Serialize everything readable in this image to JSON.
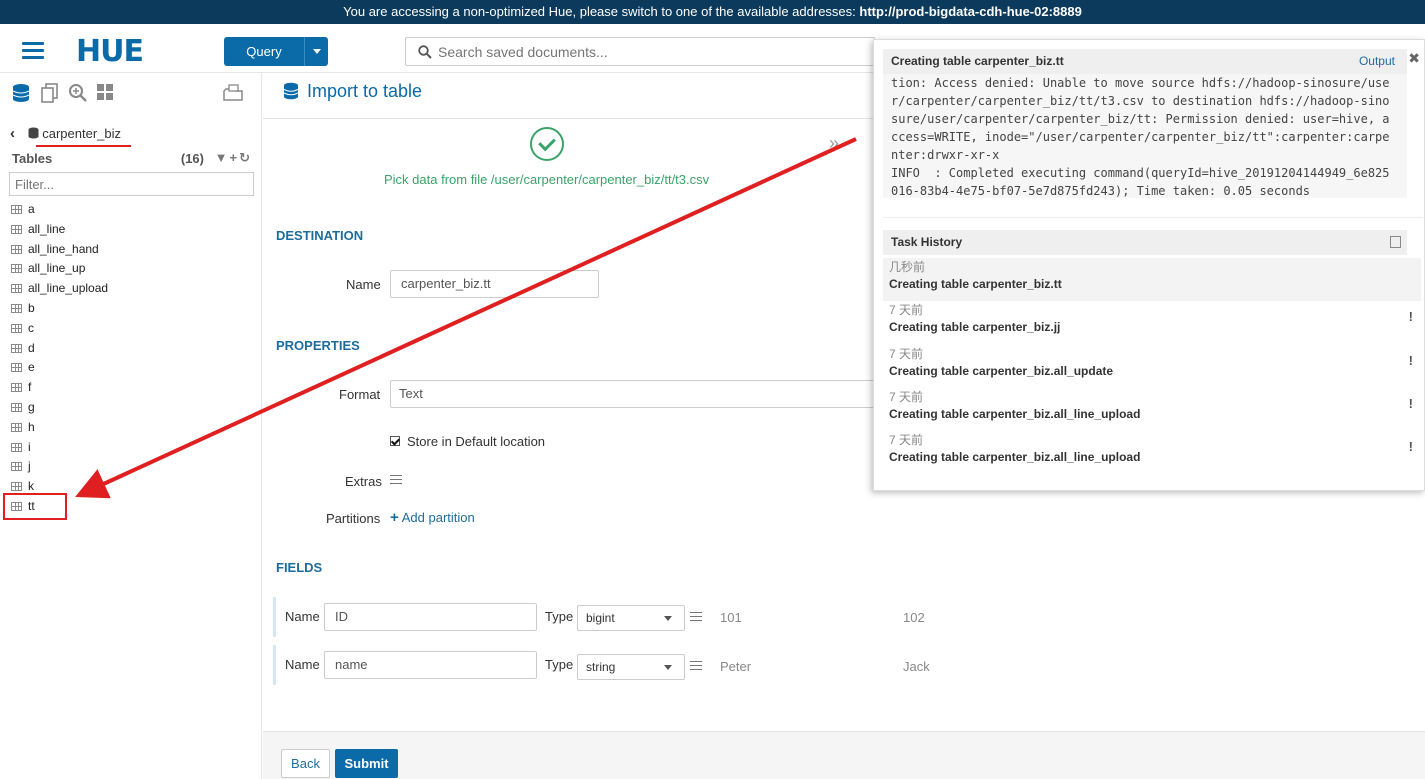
{
  "banner": {
    "text": "You are accessing a non-optimized Hue, please switch to one of the available addresses: ",
    "address": "http://prod-bigdata-cdh-hue-02:8889"
  },
  "topbar": {
    "logo": "HUE",
    "query_label": "Query",
    "search_placeholder": "Search saved documents..."
  },
  "sidebar": {
    "database": "carpenter_biz",
    "tables_label": "Tables",
    "tables_count": "(16)",
    "filter_placeholder": "Filter...",
    "tables": [
      "a",
      "all_line",
      "all_line_hand",
      "all_line_up",
      "all_line_upload",
      "b",
      "c",
      "d",
      "e",
      "f",
      "g",
      "h",
      "i",
      "j",
      "k",
      "tt"
    ]
  },
  "main": {
    "title": "Import to table",
    "step_label": "Pick data from file /user/carpenter/carpenter_biz/tt/t3.csv",
    "destination": {
      "section": "DESTINATION",
      "name_label": "Name",
      "name_value": "carpenter_biz.tt"
    },
    "properties": {
      "section": "PROPERTIES",
      "format_label": "Format",
      "format_value": "Text",
      "store_default": "Store in Default location",
      "extras_label": "Extras",
      "partitions_label": "Partitions",
      "add_partition": "Add partition"
    },
    "fields": {
      "section": "FIELDS",
      "rows": [
        {
          "name_label": "Name",
          "name": "ID",
          "type_label": "Type",
          "type": "bigint",
          "sample1": "101",
          "sample2": "102"
        },
        {
          "name_label": "Name",
          "name": "name",
          "type_label": "Type",
          "type": "string",
          "sample1": "Peter",
          "sample2": "Jack"
        }
      ]
    },
    "footer": {
      "back": "Back",
      "submit": "Submit"
    }
  },
  "panel": {
    "job_title": "Creating table carpenter_biz.tt",
    "output_link": "Output",
    "log_lines": [
      "tion: Access denied: Unable to move source hdfs://hadoop-sinosure/use",
      "r/carpenter/carpenter_biz/tt/t3.csv to destination hdfs://hadoop-sino",
      "sure/user/carpenter/carpenter_biz/tt: Permission denied: user=hive, a",
      "ccess=WRITE, inode=\"/user/carpenter/carpenter_biz/tt\":carpenter:carpe",
      "nter:drwxr-xr-x",
      "INFO  : Completed executing command(queryId=hive_20191204144949_6e825",
      "016-83b4-4e75-bf07-5e7d875fd243); Time taken: 0.05 seconds"
    ],
    "history_title": "Task History",
    "tasks": [
      {
        "time": "几秒前",
        "name": "Creating table carpenter_biz.tt"
      },
      {
        "time": "7 天前",
        "name": "Creating table carpenter_biz.jj"
      },
      {
        "time": "7 天前",
        "name": "Creating table carpenter_biz.all_update"
      },
      {
        "time": "7 天前",
        "name": "Creating table carpenter_biz.all_line_upload"
      },
      {
        "time": "7 天前",
        "name": "Creating table carpenter_biz.all_line_upload"
      }
    ]
  },
  "colors": {
    "accent": "#0b6aa8",
    "success": "#3aa36a",
    "annotation": "#e02020",
    "banner": "#0b3a5c"
  }
}
